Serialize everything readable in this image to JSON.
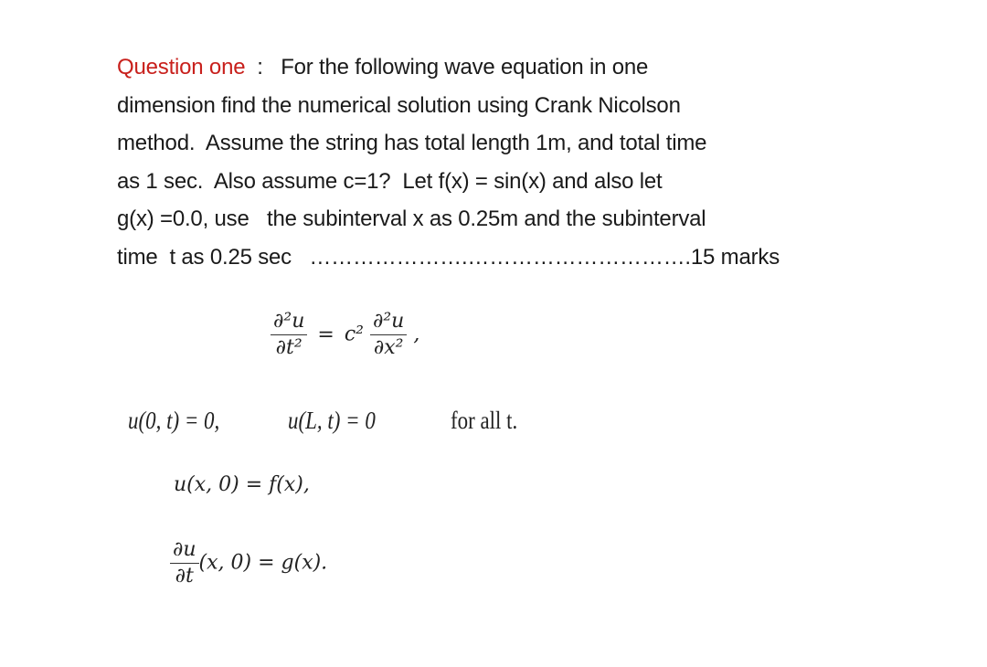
{
  "question": {
    "label": "Question one",
    "separator": "  :   ",
    "lines": [
      "For the following wave equation in one",
      "dimension find the numerical solution using Crank Nicolson",
      "method.  Assume the string has total length 1m, and total time",
      "as 1 sec.  Also assume c=1?  Let f(x) = sin(x) and also let",
      "g(x) =0.0, use   the subinterval x as 0.25m and the subinterval",
      "time  t as 0.25 sec   ………………….………………………….15 marks"
    ]
  },
  "equations": {
    "wave": {
      "lhs_num": "∂²u",
      "lhs_den": "∂t²",
      "eq": "=",
      "coef": "c²",
      "rhs_num": "∂²u",
      "rhs_den": "∂x²",
      "trail": ","
    },
    "boundary": {
      "left": "u(0, t) = 0,",
      "right": "u(L, t) = 0",
      "note": "for all t."
    },
    "initial_u": "u(x, 0) = f(x),",
    "initial_du": {
      "num": "∂u",
      "den": "∂t",
      "rest": "(x, 0) = g(x)."
    }
  }
}
